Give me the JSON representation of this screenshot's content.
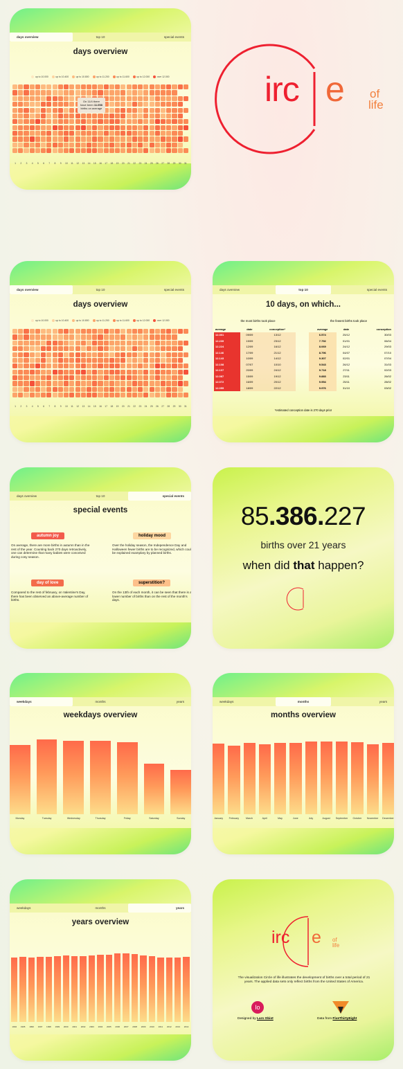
{
  "tabs": {
    "days": [
      "days overview",
      "top 10",
      "special events"
    ],
    "time": [
      "weekdays",
      "months",
      "years"
    ]
  },
  "days_overview": {
    "title": "days overview",
    "legend": [
      "up to 10.000",
      "up to 10.400",
      "up to 10.800",
      "up to 11.200",
      "up to 11.600",
      "up to 12.000",
      "over 12.000"
    ],
    "legend_colors": [
      "#fde7c0",
      "#fdd3a0",
      "#fdbb80",
      "#fca46a",
      "#fb8a56",
      "#f97048",
      "#f5513a"
    ],
    "day_numbers": [
      "1",
      "2",
      "3",
      "4",
      "5",
      "6",
      "7",
      "8",
      "9",
      "10",
      "11",
      "12",
      "13",
      "14",
      "15",
      "16",
      "17",
      "18",
      "19",
      "20",
      "21",
      "22",
      "23",
      "24",
      "25",
      "26",
      "27",
      "28",
      "29",
      "30",
      "31"
    ],
    "tooltip": {
      "line1": "On 11/4 there",
      "line2": "have been",
      "value": "11.058",
      "line3": "births on average"
    }
  },
  "logo": {
    "left": "irc",
    "mid": "e",
    "of": "of",
    "life": "life"
  },
  "top10": {
    "title": "10 days, on which...",
    "most_heading": "the most births took place",
    "fewest_heading": "the fewest births took place",
    "col_average": "average",
    "col_date": "date",
    "col_conception": "conception*",
    "col_conception_plain": "conception",
    "most": [
      [
        "12.301",
        "09/09",
        "13/12"
      ],
      [
        "12.239",
        "19/09",
        "23/12"
      ],
      [
        "12.224",
        "12/09",
        "16/12"
      ],
      [
        "12.146",
        "17/09",
        "21/12"
      ],
      [
        "12.143",
        "10/09",
        "14/12"
      ],
      [
        "12.108",
        "07/07",
        "10/10"
      ],
      [
        "12.107",
        "20/09",
        "24/12"
      ],
      [
        "12.087",
        "15/09",
        "19/12"
      ],
      [
        "12.072",
        "16/09",
        "20/12"
      ],
      [
        "12.055",
        "18/09",
        "22/12"
      ]
    ],
    "fewest": [
      [
        "6.574",
        "25/12",
        "30/03"
      ],
      [
        "7.792",
        "01/01",
        "06/04"
      ],
      [
        "8.069",
        "24/12",
        "29/03"
      ],
      [
        "8.796",
        "04/07",
        "07/10"
      ],
      [
        "9.307",
        "02/01",
        "07/04"
      ],
      [
        "9.543",
        "26/12",
        "31/03"
      ],
      [
        "9.718",
        "27/11",
        "02/03"
      ],
      [
        "9.883",
        "23/11",
        "26/02"
      ],
      [
        "9.954",
        "25/11",
        "28/02"
      ],
      [
        "9.976",
        "31/10",
        "03/02"
      ]
    ],
    "footnote": "*estimated conception date is 270 days prior"
  },
  "special": {
    "title": "special events",
    "events": [
      {
        "tag": "autumn joy",
        "text": "On average, there are more births in autumn than in the rest of the year. Counting back 270 days retroactively, one can determine that many babies were conceived during cosy season."
      },
      {
        "tag": "holiday mood",
        "text": "Over the holiday season, the Independence Day and Halloween fewer births are to be recognized, which could be explained examplary by planned births."
      },
      {
        "tag": "day of love",
        "text": "Compared to the rest of february, on Valentine's Day, there has been observed an above-average number of births."
      },
      {
        "tag": "superstition?",
        "text": "On the 13th of each month, it can be seen that there is a lower number of births than on the rest of the month's days."
      }
    ]
  },
  "stats": {
    "number_a": "85",
    "number_b": ".386.",
    "number_c": "227",
    "subtitle": "births over 21 years",
    "question_a": "when did ",
    "question_b": "that",
    "question_c": " happen?"
  },
  "weekdays": {
    "title": "weekdays overview",
    "chart_data": {
      "type": "bar",
      "categories": [
        "Monday",
        "Tuesday",
        "Wednesday",
        "Thursday",
        "Friday",
        "Saturday",
        "Sunday"
      ],
      "values": [
        11900,
        12850,
        12600,
        12600,
        12400,
        8650,
        7600
      ],
      "ylim": [
        0,
        14000
      ]
    }
  },
  "months": {
    "title": "months overview",
    "chart_data": {
      "type": "bar",
      "categories": [
        "January",
        "February",
        "March",
        "April",
        "May",
        "June",
        "July",
        "August",
        "September",
        "October",
        "November",
        "December"
      ],
      "values": [
        10900,
        10600,
        11000,
        10850,
        11050,
        11000,
        11250,
        11300,
        11200,
        11100,
        10850,
        11050
      ],
      "ylim": [
        0,
        12000
      ]
    }
  },
  "years": {
    "title": "years overview",
    "chart_data": {
      "type": "bar",
      "categories": [
        "1994",
        "1995",
        "1996",
        "1997",
        "1998",
        "1999",
        "2000",
        "2001",
        "2002",
        "2003",
        "2004",
        "2005",
        "2006",
        "2007",
        "2008",
        "2009",
        "2010",
        "2011",
        "2012",
        "2013",
        "2014"
      ],
      "values": [
        10800,
        10850,
        10800,
        10850,
        10900,
        10950,
        11100,
        11050,
        11000,
        11100,
        11200,
        11250,
        11450,
        11500,
        11400,
        11150,
        10950,
        10800,
        10800,
        10750,
        10850
      ],
      "ylim": [
        0,
        12500
      ]
    }
  },
  "about": {
    "text": "The visualization Circle of life illustrates the development of births over a total period of 21 years. The applied data sets only reflect births from the United States of America.",
    "designed_by": "Designed by ",
    "designer": "Lars Obist",
    "data_from": "Data from ",
    "source": "FiveThirtyEight",
    "designer_badge": "lo"
  },
  "colors": {
    "accent": "#f02b2b",
    "orange": "#f2723c",
    "table_red": "#e8342e"
  }
}
